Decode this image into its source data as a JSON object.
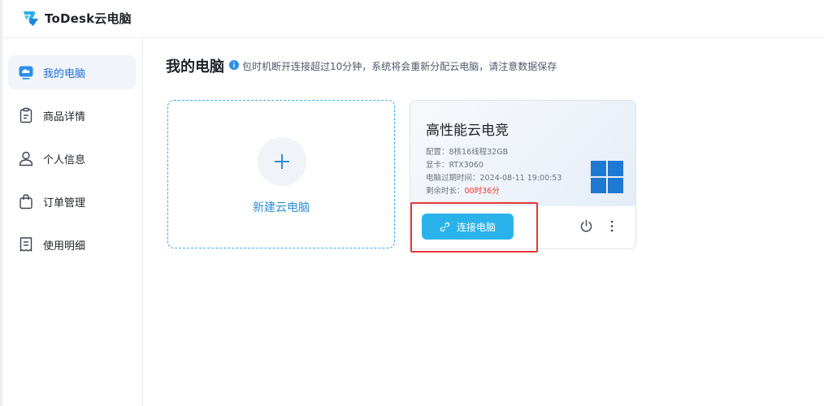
{
  "app": {
    "brand": "ToDesk云电脑"
  },
  "sidebar": {
    "items": [
      {
        "label": "我的电脑",
        "icon": "cloud-monitor-icon",
        "active": true
      },
      {
        "label": "商品详情",
        "icon": "clipboard-icon",
        "active": false
      },
      {
        "label": "个人信息",
        "icon": "user-icon",
        "active": false
      },
      {
        "label": "订单管理",
        "icon": "shopping-bag-icon",
        "active": false
      },
      {
        "label": "使用明细",
        "icon": "receipt-icon",
        "active": false
      }
    ]
  },
  "main": {
    "title": "我的电脑",
    "notice": "包时机断开连接超过10分钟，系统将会重新分配云电脑，请注意数据保存",
    "new_card": {
      "label": "新建云电脑"
    },
    "pc_card": {
      "name": "高性能云电竞",
      "config": "配置：8核16线程32GB",
      "gpu": "显卡：RTX3060",
      "expire": "电脑过期时间：2024-08-11 19:00:53",
      "remaining_label": "剩余时长：",
      "remaining_value": "00时36分",
      "connect_label": "连接电脑"
    }
  },
  "colors": {
    "accent": "#2ab3ea",
    "active_text": "#1a6fd8",
    "warning": "#e8362f",
    "highlight": "#e53935",
    "windows_blue": "#1f78d1"
  }
}
